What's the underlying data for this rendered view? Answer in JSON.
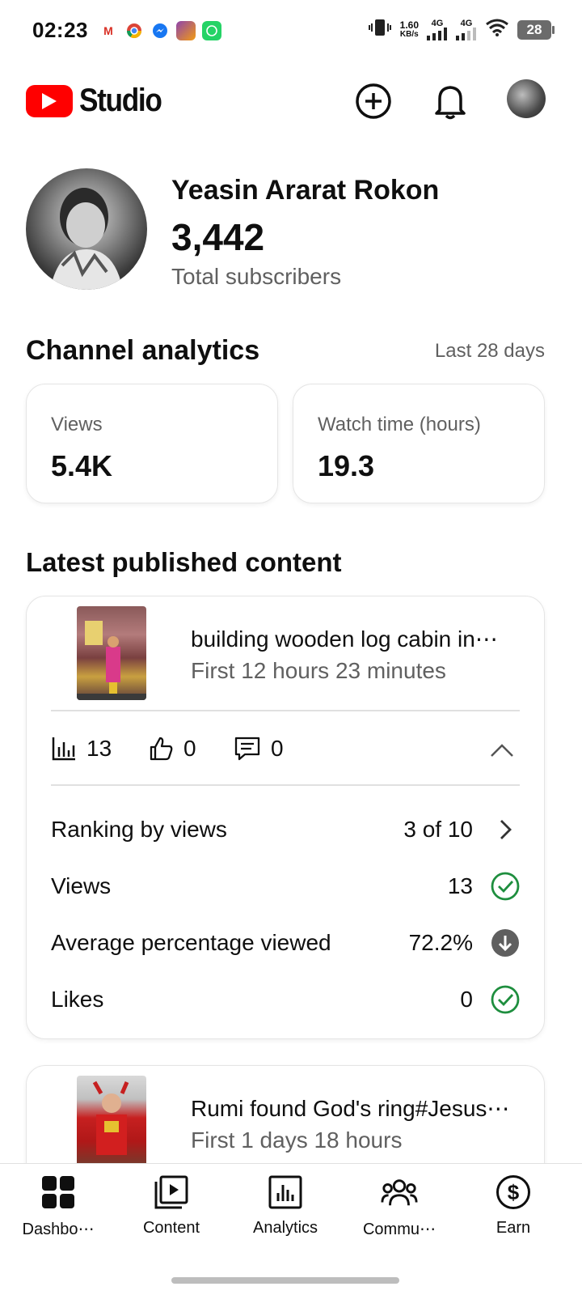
{
  "status_bar": {
    "time": "02:23",
    "net_speed_value": "1.60",
    "net_speed_unit": "KB/s",
    "signal1": "4G",
    "signal2": "4G",
    "battery": "28"
  },
  "header": {
    "app_name": "Studio"
  },
  "channel": {
    "name": "Yeasin Ararat Rokon",
    "subscriber_count": "3,442",
    "subscriber_label": "Total subscribers"
  },
  "analytics": {
    "title": "Channel analytics",
    "range": "Last 28 days",
    "cards": [
      {
        "label": "Views",
        "value": "5.4K"
      },
      {
        "label": "Watch time (hours)",
        "value": "19.3"
      }
    ]
  },
  "latest": {
    "title": "Latest published content",
    "items": [
      {
        "title": "building wooden log cabin in⋯",
        "age": "First 12 hours 23 minutes",
        "views": "13",
        "likes": "0",
        "comments": "0",
        "rows": [
          {
            "label": "Ranking by views",
            "value": "3 of 10",
            "icon": "chevron-right-icon"
          },
          {
            "label": "Views",
            "value": "13",
            "icon": "check-circle-icon"
          },
          {
            "label": "Average percentage viewed",
            "value": "72.2%",
            "icon": "arrow-down-circle-icon"
          },
          {
            "label": "Likes",
            "value": "0",
            "icon": "check-circle-icon"
          }
        ]
      },
      {
        "title": "Rumi found God's ring#Jesus⋯",
        "age": "First 1 days 18 hours"
      }
    ]
  },
  "bottom_nav": [
    {
      "label": "Dashbo⋯",
      "icon": "dashboard-icon"
    },
    {
      "label": "Content",
      "icon": "content-icon"
    },
    {
      "label": "Analytics",
      "icon": "analytics-icon"
    },
    {
      "label": "Commu⋯",
      "icon": "community-icon"
    },
    {
      "label": "Earn",
      "icon": "earn-icon"
    }
  ],
  "colors": {
    "brand_red": "#ff0000",
    "success_green": "#1e8e3e",
    "secondary_text": "#606060"
  }
}
